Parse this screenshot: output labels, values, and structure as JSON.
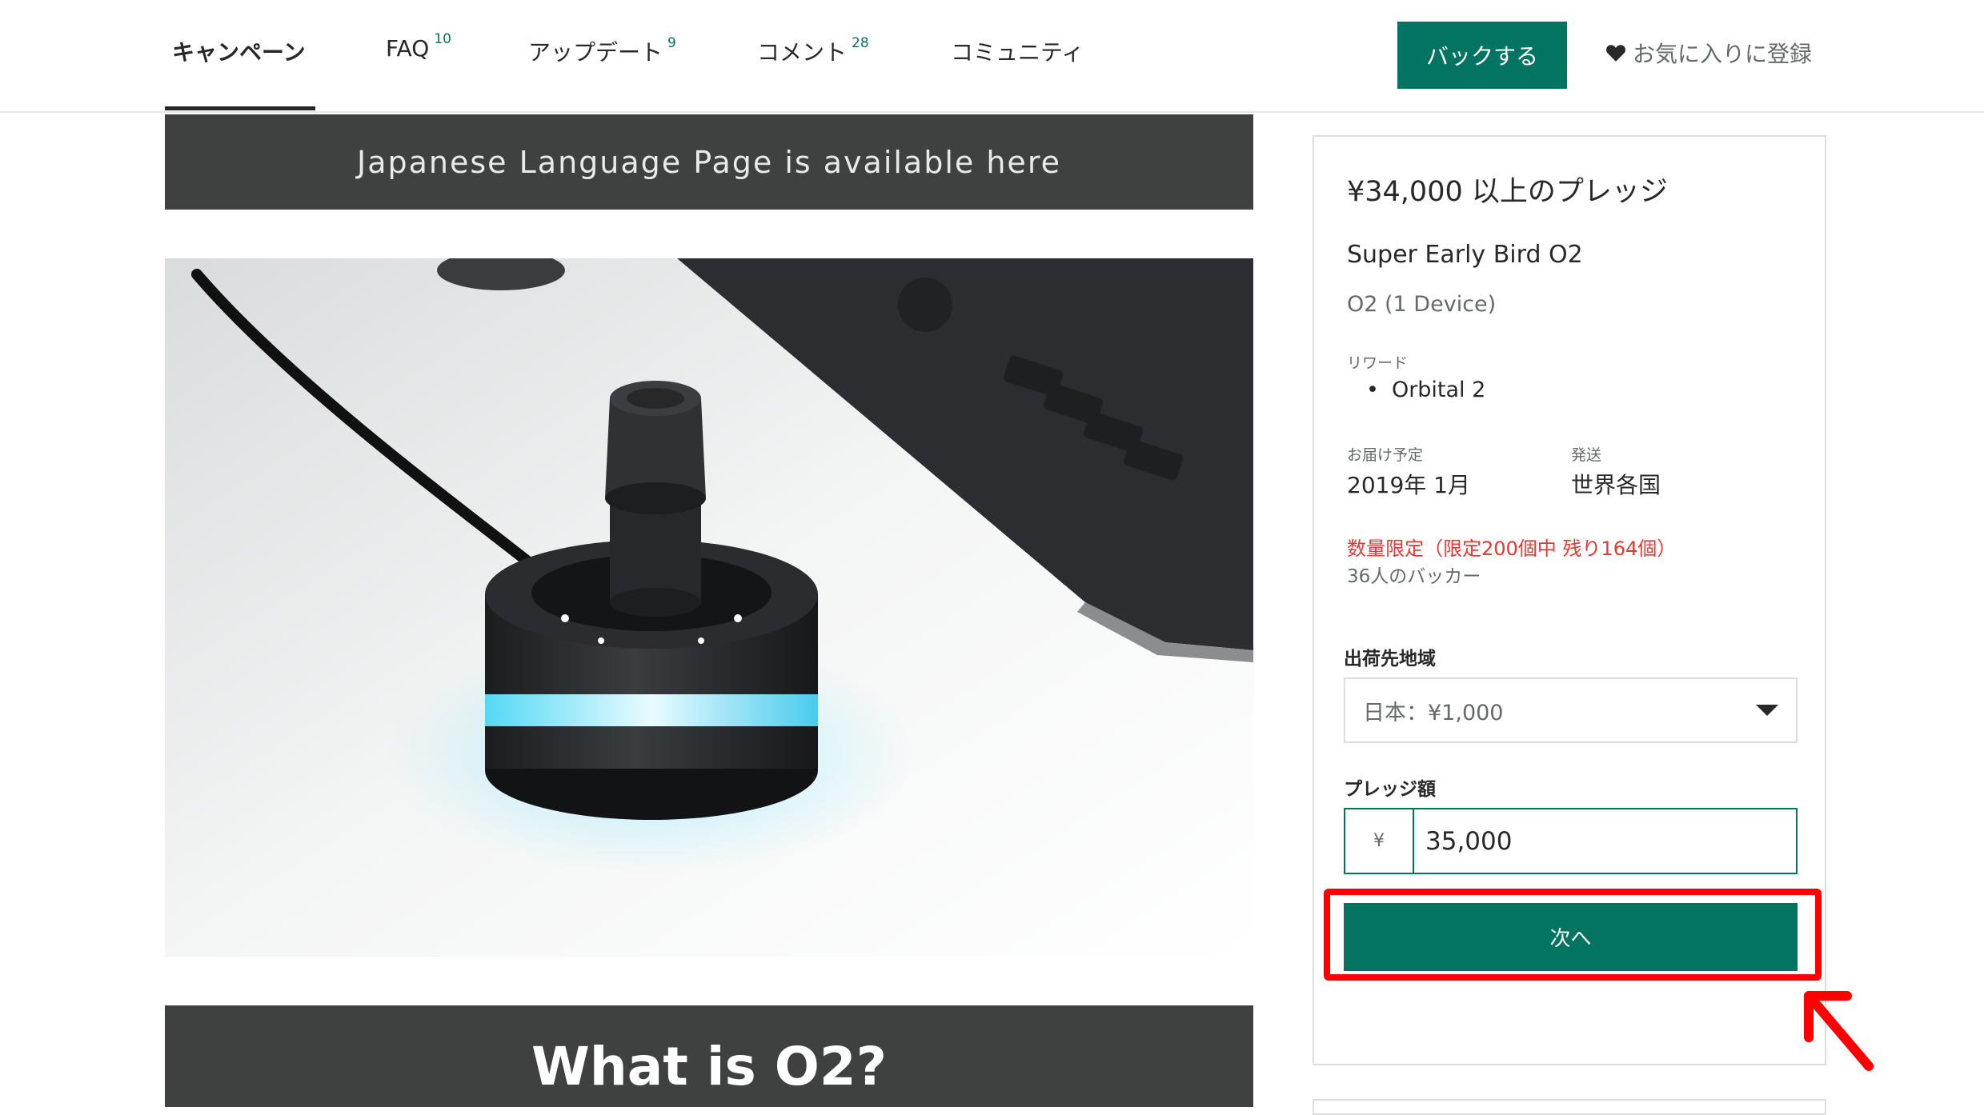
{
  "nav": {
    "tabs": [
      {
        "label": "キャンペーン",
        "count": ""
      },
      {
        "label": "FAQ",
        "count": "10"
      },
      {
        "label": "アップデート",
        "count": "9"
      },
      {
        "label": "コメント",
        "count": "28"
      },
      {
        "label": "コミュニティ",
        "count": ""
      }
    ],
    "back_button": "バックする",
    "favorite": "お気に入りに登録"
  },
  "main": {
    "banner_top": "Japanese Language Page is available here",
    "banner_bottom": "What is O2?"
  },
  "pledge": {
    "title": "¥34,000 以上のプレッジ",
    "reward_name": "Super Early Bird O2",
    "reward_subtitle": "O2 (1 Device)",
    "rewards_label": "リワード",
    "rewards": [
      "Orbital 2"
    ],
    "delivery_label": "お届け予定",
    "delivery_value": "2019年 1月",
    "shipping_label": "発送",
    "shipping_value": "世界各国",
    "limit_text": "数量限定（限定200個中 残り164個）",
    "backers_text": "36人のバッカー",
    "region_label": "出荷先地域",
    "region_value": "日本：¥1,000",
    "amount_label": "プレッジ額",
    "currency_symbol": "¥",
    "amount_value": "35,000",
    "next_button": "次へ"
  },
  "colors": {
    "accent": "#037362",
    "highlight": "#ff0000",
    "dark_banner": "#3f4040",
    "limit_text": "#e53935"
  }
}
